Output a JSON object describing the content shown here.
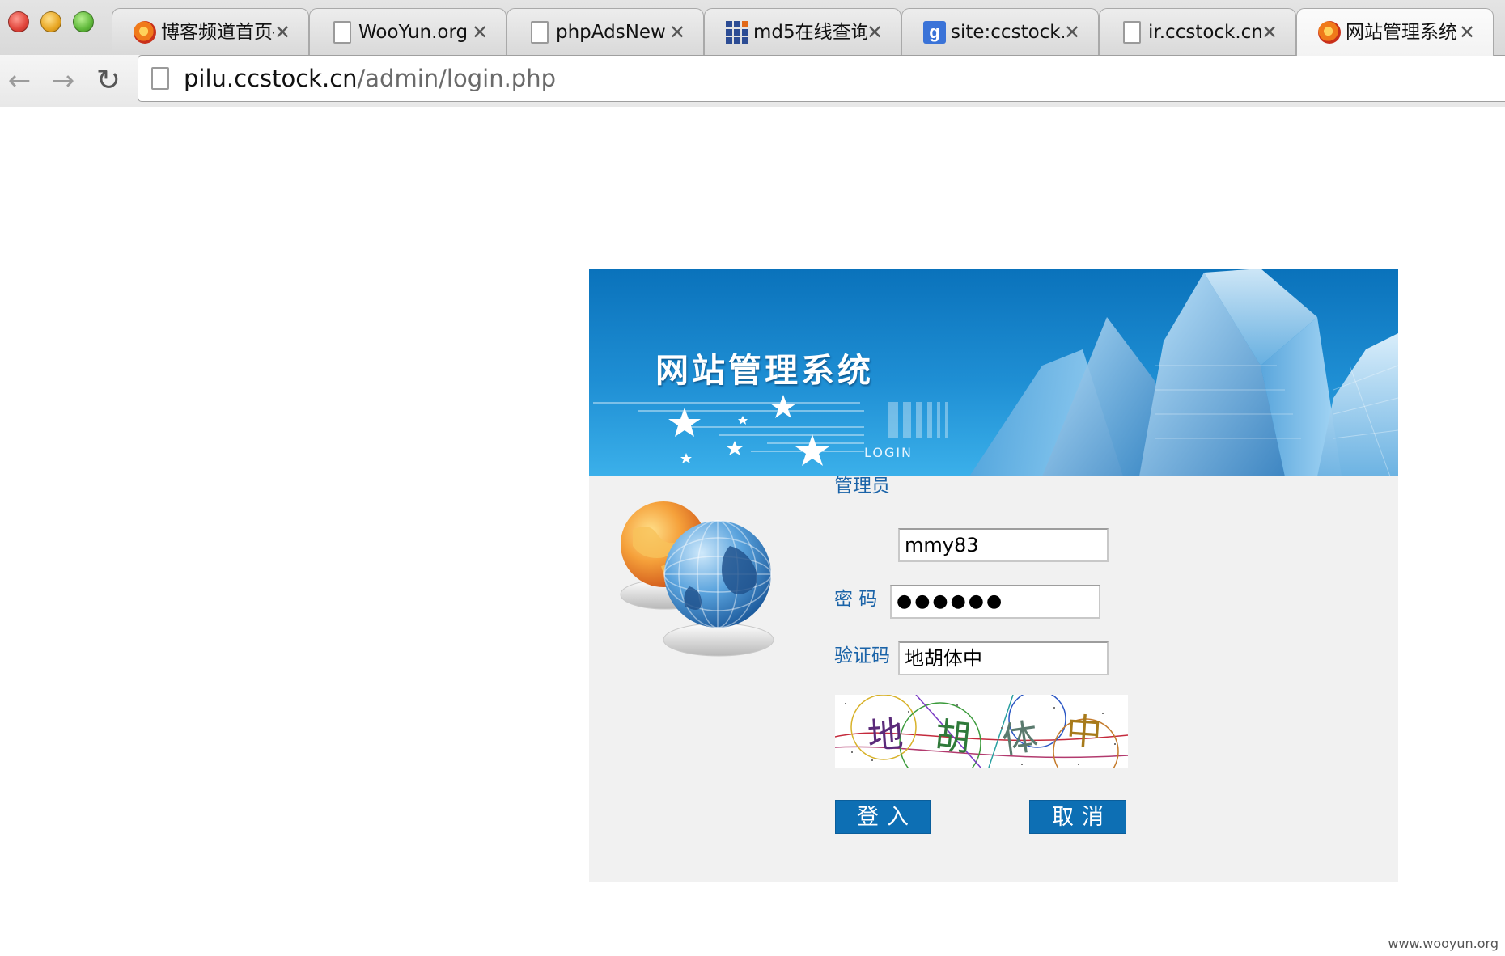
{
  "browser": {
    "tabs": [
      {
        "title": "博客频道首页-",
        "icon": "blog-favicon-icon",
        "active": false
      },
      {
        "title": "WooYun.org",
        "icon": "page-icon",
        "active": false
      },
      {
        "title": "phpAdsNew",
        "icon": "page-icon",
        "active": false
      },
      {
        "title": "md5在线查询",
        "icon": "grid-favicon-icon",
        "active": false
      },
      {
        "title": "site:ccstock.c",
        "icon": "google-favicon-icon",
        "active": false
      },
      {
        "title": "ir.ccstock.cn/",
        "icon": "page-icon",
        "active": false
      },
      {
        "title": "网站管理系统",
        "icon": "blog-favicon-icon",
        "active": true
      }
    ],
    "tab_close": "✕",
    "google_letter": "g",
    "url_host": "pilu.ccstock.cn",
    "url_path": "/admin/login.php",
    "back_glyph": "←",
    "forward_glyph": "→",
    "reload_glyph": "↻"
  },
  "login": {
    "banner_title": "网站管理系统",
    "banner_subtitle": "LOGIN",
    "username_label": "管理员",
    "username_value": "mmy83",
    "password_label": "密 码",
    "password_value": "●●●●●●",
    "captcha_label": "验证码",
    "captcha_value": "地胡体中",
    "captcha_chars": [
      "地",
      "胡",
      "体",
      "中"
    ],
    "login_button": "登入",
    "cancel_button": "取消"
  },
  "colors": {
    "label_blue": "#1a63a8",
    "button_blue": "#0d6fb4",
    "banner_blue": "#1f8fd4",
    "panel_bg": "#f1f1f1"
  },
  "watermark": "www.wooyun.org"
}
